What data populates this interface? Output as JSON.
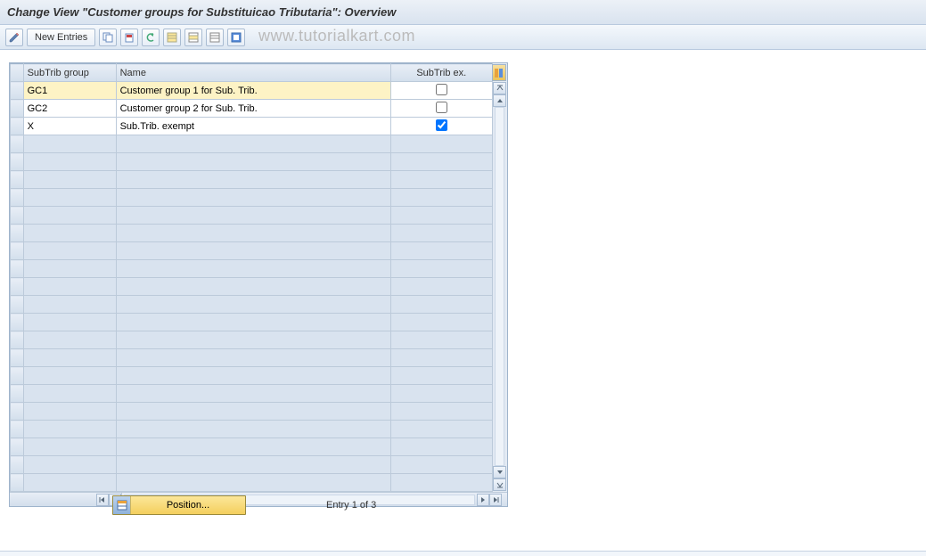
{
  "title": "Change View \"Customer groups for Substituicao Tributaria\": Overview",
  "toolbar": {
    "new_entries_label": "New Entries"
  },
  "watermark": "www.tutorialkart.com",
  "columns": {
    "group": "SubTrib group",
    "name": "Name",
    "ex": "SubTrib ex."
  },
  "rows": [
    {
      "group": "GC1",
      "name": "Customer group 1 for Sub. Trib.",
      "ex": false,
      "active": true
    },
    {
      "group": "GC2",
      "name": "Customer group 2 for Sub. Trib.",
      "ex": false,
      "active": false
    },
    {
      "group": "X",
      "name": "Sub.Trib. exempt",
      "ex": true,
      "active": false
    }
  ],
  "empty_row_count": 20,
  "footer": {
    "position_label": "Position...",
    "entry_text": "Entry 1 of 3"
  }
}
